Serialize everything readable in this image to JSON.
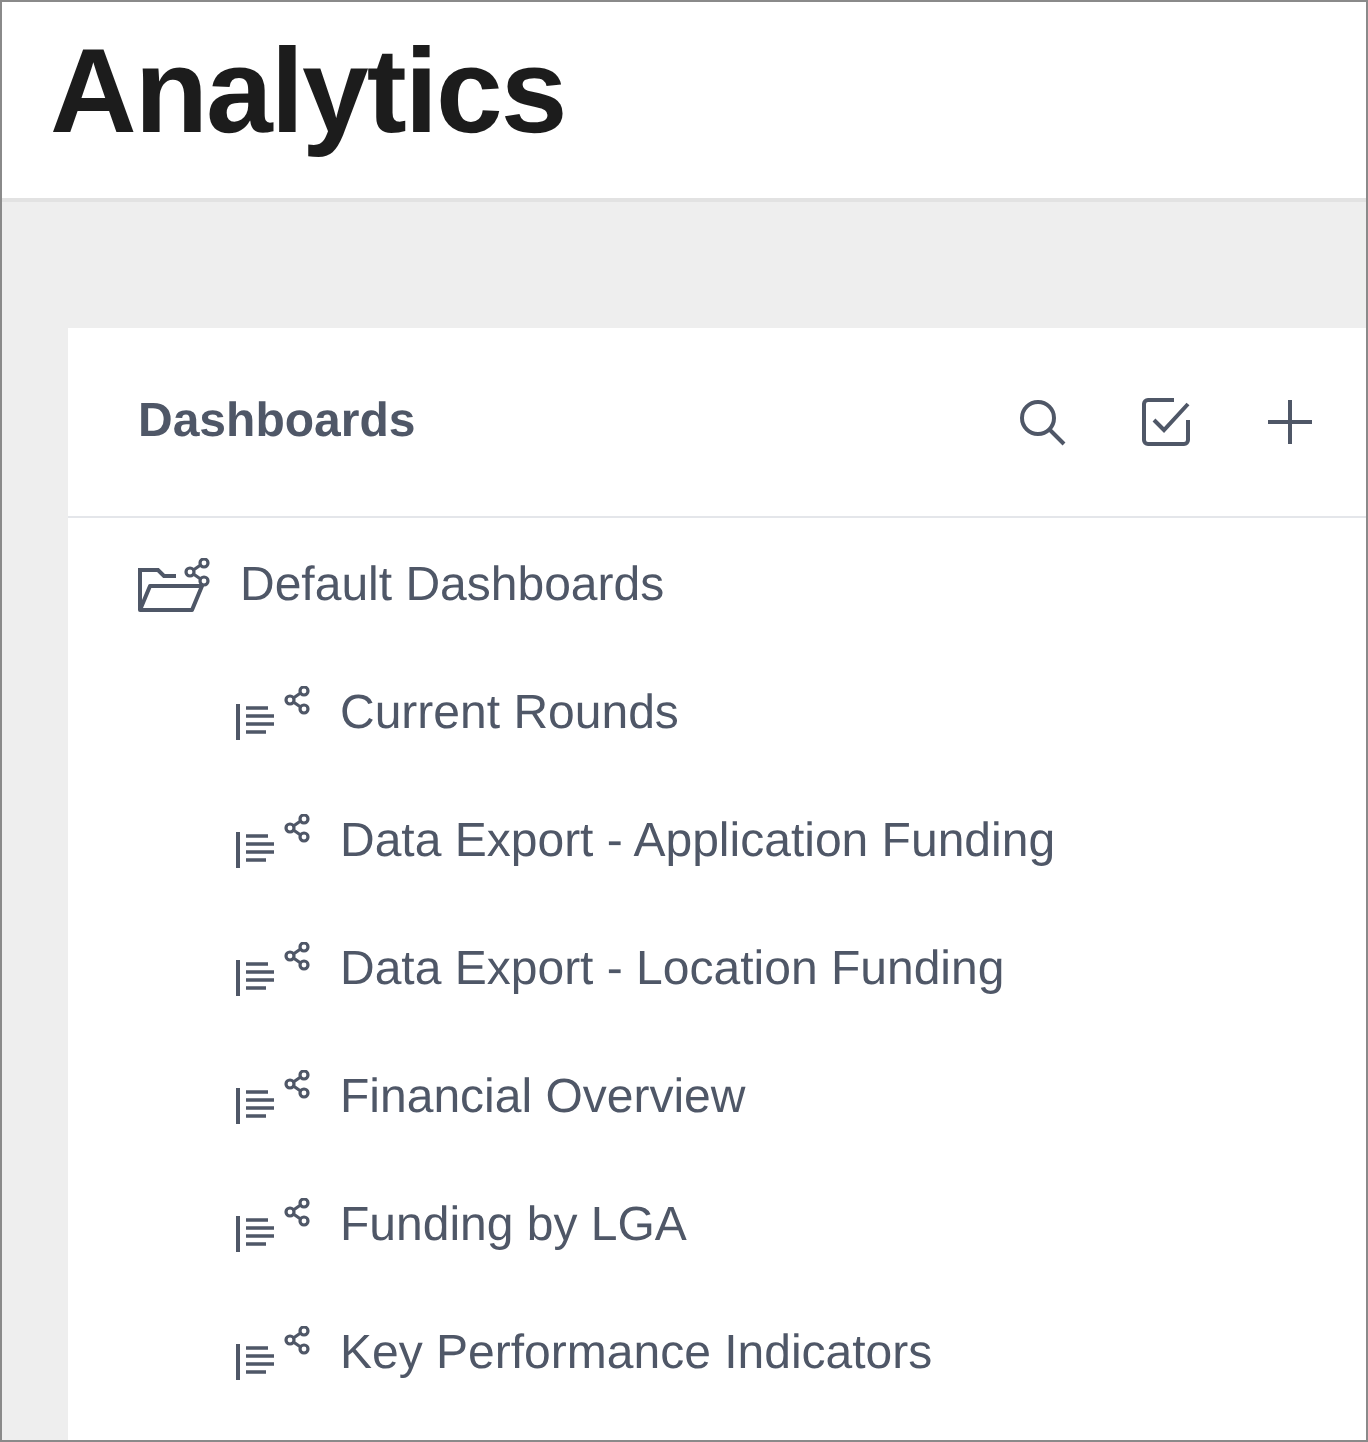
{
  "header": {
    "title": "Analytics"
  },
  "panel": {
    "title": "Dashboards",
    "actions": [
      {
        "kind": "search"
      },
      {
        "kind": "select"
      },
      {
        "kind": "add"
      }
    ],
    "tree": [
      {
        "kind": "folder",
        "label": "Default Dashboards",
        "children": [
          {
            "kind": "dashboard",
            "label": "Current Rounds"
          },
          {
            "kind": "dashboard",
            "label": "Data Export - Application Funding"
          },
          {
            "kind": "dashboard",
            "label": "Data Export - Location Funding"
          },
          {
            "kind": "dashboard",
            "label": "Financial Overview"
          },
          {
            "kind": "dashboard",
            "label": "Funding by LGA"
          },
          {
            "kind": "dashboard",
            "label": "Key Performance Indicators"
          }
        ]
      }
    ]
  }
}
